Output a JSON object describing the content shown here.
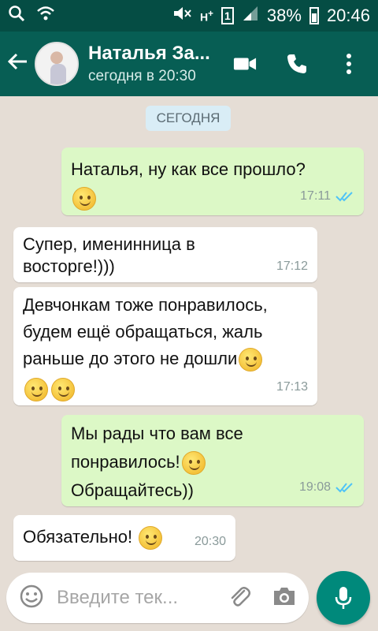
{
  "status_bar": {
    "battery": "38%",
    "time": "20:46",
    "sim_badge": "1"
  },
  "header": {
    "contact_name": "Наталья За...",
    "last_seen": "сегодня в 20:30"
  },
  "chat": {
    "date_label": "СЕГОДНЯ",
    "messages": [
      {
        "dir": "out",
        "text": "Наталья, ну как все прошло?",
        "time": "17:11"
      },
      {
        "dir": "in",
        "text": "Супер, именинница в восторге!)))",
        "time": "17:12"
      },
      {
        "dir": "in",
        "text": "Девчонкам тоже понравилось, будем ещё обращаться, жаль раньше до этого не дошли",
        "time": "17:13"
      },
      {
        "dir": "out",
        "text": "Мы рады что вам все понравилось!",
        "text2": "Обращайтесь))",
        "time": "19:08"
      },
      {
        "dir": "in",
        "text": "Обязательно!",
        "time": "20:30"
      }
    ]
  },
  "input": {
    "placeholder": "Введите тек..."
  },
  "colors": {
    "header": "#075e54",
    "status_bar": "#054d44",
    "outgoing_bubble": "#dcf8c6",
    "incoming_bubble": "#ffffff",
    "read_ticks": "#4fc3f7",
    "mic_button": "#00897b"
  },
  "icons": [
    "search-icon",
    "wifi-icon",
    "mute-icon",
    "signal-icon",
    "battery-icon",
    "back-arrow-icon",
    "video-call-icon",
    "phone-icon",
    "more-vert-icon",
    "emoji-icon",
    "attach-icon",
    "camera-icon",
    "mic-icon",
    "double-check-icon"
  ]
}
